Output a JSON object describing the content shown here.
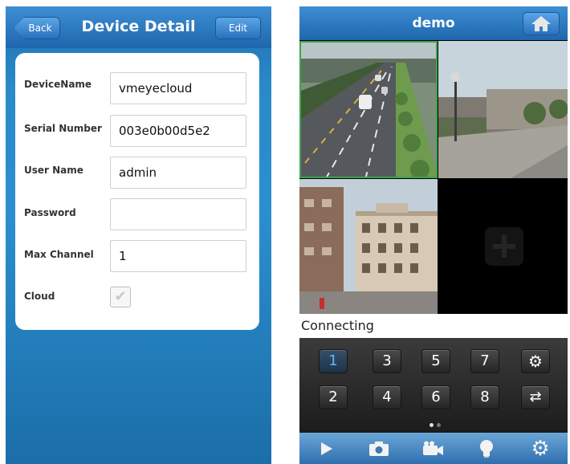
{
  "device_detail": {
    "title": "Device Detail",
    "back_label": "Back",
    "edit_label": "Edit",
    "fields": [
      {
        "label": "DeviceName",
        "value": "vmeyecloud"
      },
      {
        "label": "Serial Number",
        "value": "003e0b00d5e2"
      },
      {
        "label": "User Name",
        "value": "admin"
      },
      {
        "label": "Password",
        "value": ""
      },
      {
        "label": "Max Channel",
        "value": "1"
      }
    ],
    "cloud_label": "Cloud",
    "cloud_checked": true
  },
  "live_view": {
    "title": "demo",
    "status_text": "Connecting",
    "channels_row1": [
      "1",
      "3",
      "5",
      "7"
    ],
    "channels_row2": [
      "2",
      "4",
      "6",
      "8"
    ],
    "selected_channel": "1",
    "page_dots": 2,
    "active_page": 1,
    "empty_slot_icon": "plus-icon",
    "toolbar_icons": [
      "play-icon",
      "camera-icon",
      "video-camera-icon",
      "lightbulb-icon",
      "gear-icon"
    ]
  },
  "colors": {
    "header_blue": "#1f67ad",
    "selected_channel_text": "#5fb6ff",
    "active_tile_border": "#3fa34d"
  }
}
